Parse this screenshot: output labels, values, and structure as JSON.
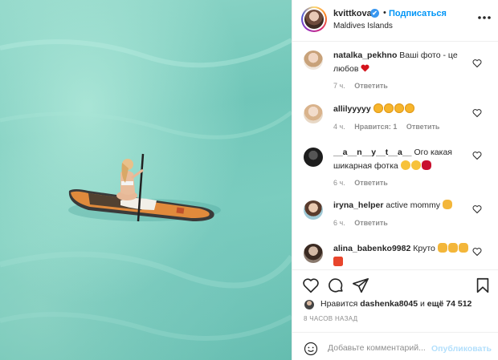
{
  "header": {
    "username": "kvittkova",
    "verified_mark": "✔",
    "separator": "•",
    "follow_label": "Подписаться",
    "location": "Maldives Islands",
    "more_icon": "more-horizontal-icon"
  },
  "comments": [
    {
      "user": "natalka_pekhno",
      "text": "Ваші фото - це любов",
      "emojis": [
        "red-heart"
      ],
      "time": "7 ч.",
      "likes": "",
      "reply": "Ответить"
    },
    {
      "user": "allilyyyyy",
      "text": "",
      "emojis": [
        "heart-eyes",
        "heart-eyes",
        "heart-eyes",
        "heart-eyes"
      ],
      "time": "4 ч.",
      "likes": "Нравится: 1",
      "reply": "Ответить"
    },
    {
      "user": "__a__n__y__t__a__",
      "text": "Ого какая шикарная фотка",
      "emojis": [
        "grin",
        "grin",
        "lips"
      ],
      "time": "6 ч.",
      "likes": "",
      "reply": "Ответить"
    },
    {
      "user": "iryna_helper",
      "text": "active mommy",
      "emojis": [
        "hand-wave"
      ],
      "time": "6 ч.",
      "likes": "",
      "reply": "Ответить"
    },
    {
      "user": "alina_babenko9982",
      "text": "Круто",
      "emojis": [
        "thumbs-up",
        "thumbs-up",
        "thumbs-up",
        "collision"
      ],
      "time": "",
      "likes": "",
      "reply": ""
    }
  ],
  "likes": {
    "prefix": "Нравится",
    "user": "dashenka8045",
    "middle": "и",
    "count": "ещё 74 512"
  },
  "time_ago": "8 ЧАСОВ НАЗАД",
  "add_comment": {
    "placeholder": "Добавьте комментарий...",
    "post_label": "Опубликовать"
  },
  "colors": {
    "link": "#0095f6",
    "muted": "#8e8e8e",
    "border": "#efefef",
    "post_disabled": "#b2dffc"
  }
}
